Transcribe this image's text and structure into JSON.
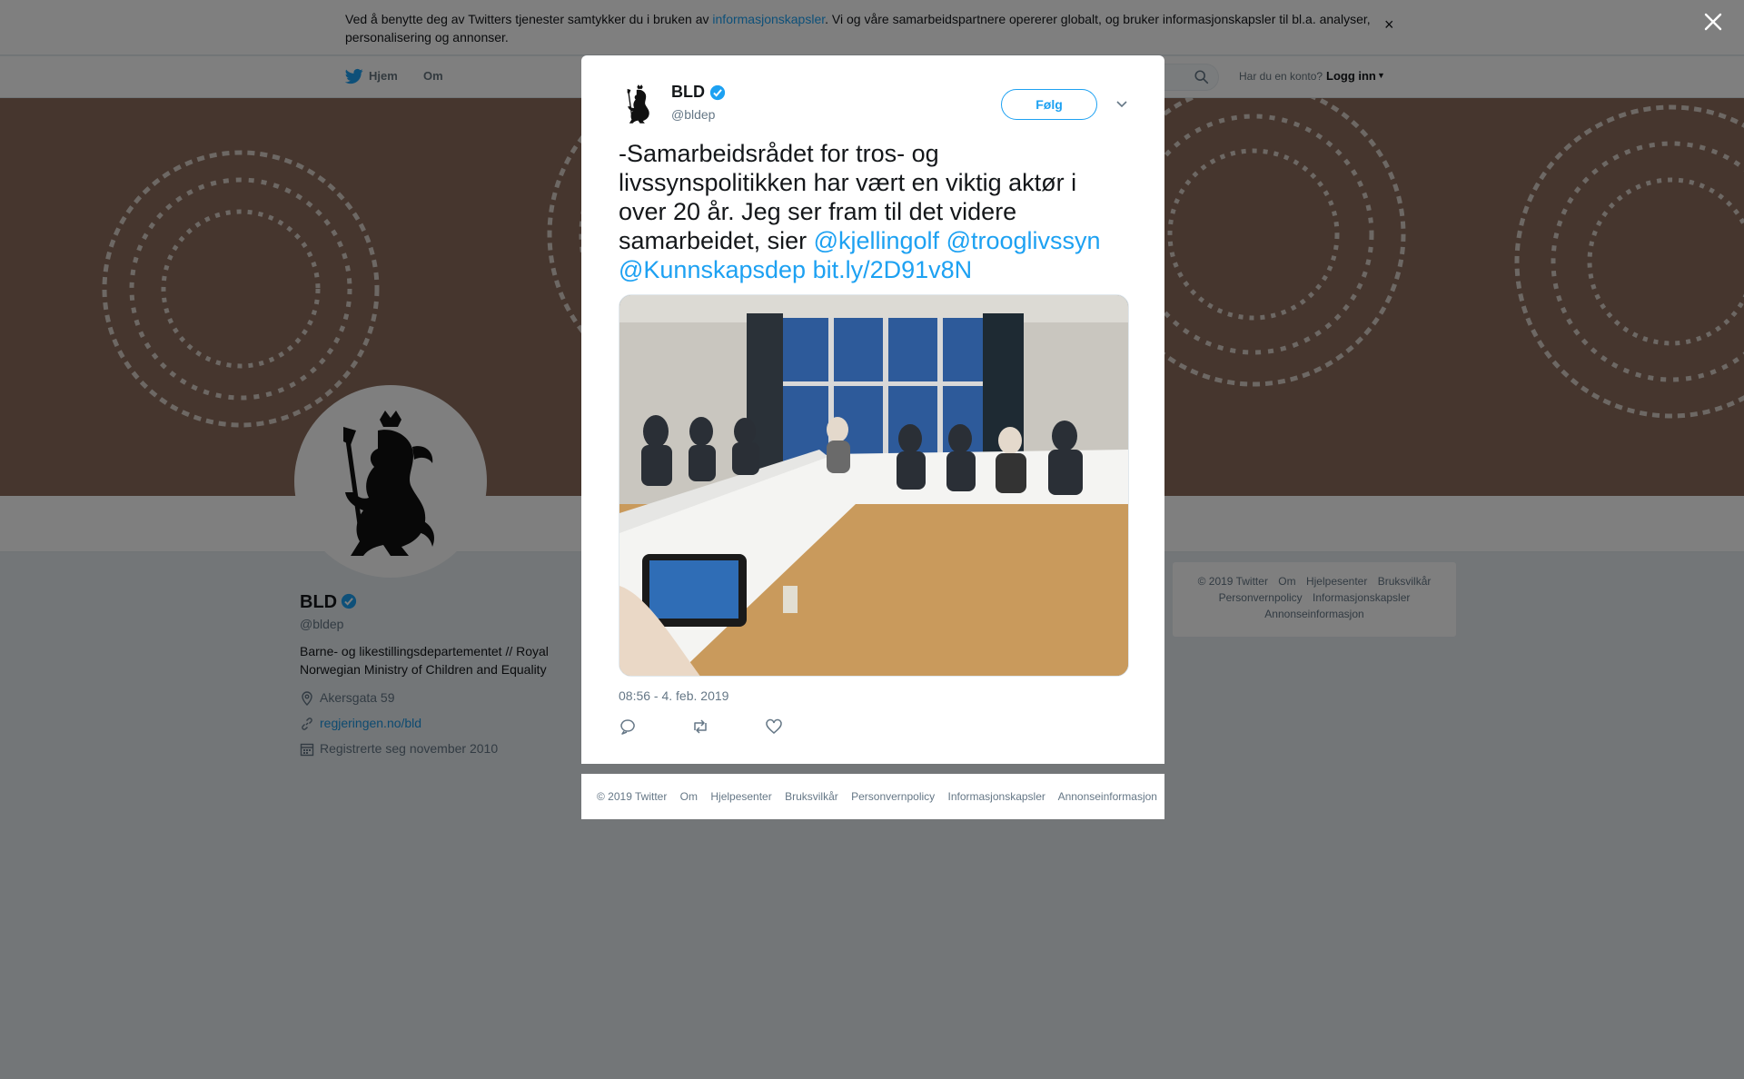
{
  "cookie_banner": {
    "text_before": "Ved å benytte deg av Twitters tjenester samtykker du i bruken av ",
    "link": "informasjonskapsler",
    "text_after": ". Vi og våre samarbeidspartnere opererer globalt, og bruker informasjonskapsler til bl.a. analyser, personalisering og annonser.",
    "close": "×"
  },
  "nav": {
    "home": "Hjem",
    "about": "Om",
    "login_question": "Har du en konto?",
    "login": "Logg inn"
  },
  "profile": {
    "name": "BLD",
    "handle": "@bldep",
    "bio": "Barne- og likestillingsdepartementet // Royal Norwegian Ministry of Children and Equality",
    "location": "Akersgata 59",
    "website": "regjeringen.no/bld",
    "joined": "Registrerte seg november 2010"
  },
  "side_footer": {
    "line1": [
      "© 2019 Twitter",
      "Om",
      "Hjelpesenter",
      "Bruksvilkår"
    ],
    "line2": [
      "Personvernpolicy",
      "Informasjonskapsler"
    ],
    "line3": [
      "Annonseinformasjon"
    ]
  },
  "tweet": {
    "author_name": "BLD",
    "author_handle": "@bldep",
    "follow_label": "Følg",
    "text": "-Samarbeidsrådet for tros- og livssynspolitikken har vært en viktig aktør i over 20 år. Jeg ser fram til det videre samarbeidet, sier ",
    "mention1": "@kjellingolf",
    "mention2": "@trooglivssyn",
    "mention3": "@Kunnskapsdep",
    "url": "bit.ly/2D91v8N",
    "timestamp": "08:56 - 4. feb. 2019"
  },
  "modal_footer": [
    "© 2019 Twitter",
    "Om",
    "Hjelpesenter",
    "Bruksvilkår",
    "Personvernpolicy",
    "Informasjonskapsler",
    "Annonseinformasjon"
  ],
  "colors": {
    "twitter_blue": "#1da1f2",
    "banner_brown": "#8c6d5d",
    "verified": "#1da1f2"
  },
  "icons": [
    "twitter-bird-icon",
    "search-icon",
    "close-icon",
    "verified-icon",
    "chevron-down-icon",
    "location-icon",
    "link-icon",
    "calendar-icon",
    "reply-icon",
    "retweet-icon",
    "like-icon",
    "coat-of-arms-logo"
  ]
}
